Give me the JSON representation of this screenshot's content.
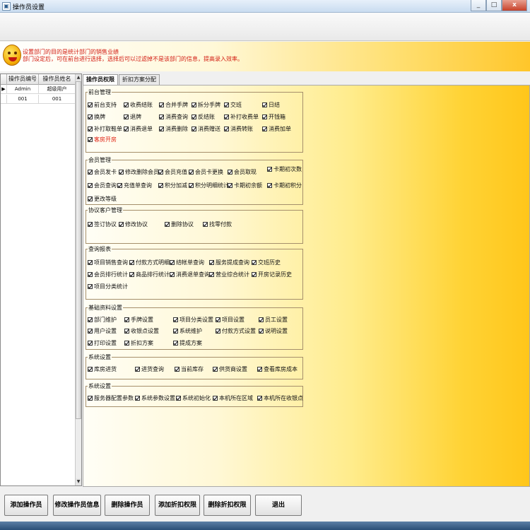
{
  "window": {
    "title": "操作员设置",
    "close_label": "x"
  },
  "notice": {
    "line1": "设置部门的目的是统计部门的销售业绩",
    "line2": "部门设定后，可在前台进行选择，选择后可以过滤掉不是该部门的信息，提高录入效率。"
  },
  "grid": {
    "headers": [
      "操作员编号",
      "操作员姓名"
    ],
    "rows": [
      {
        "indicator": "▶",
        "id": "Admin",
        "name": "超级用户"
      },
      {
        "indicator": "",
        "id": "001",
        "name": "001"
      }
    ]
  },
  "tabs": [
    {
      "label": "操作员权限",
      "active": true
    },
    {
      "label": "折扣方案分配",
      "active": false
    }
  ],
  "groups": [
    {
      "title": "前台管理",
      "items": [
        "前台支持",
        "收费结账",
        "合并手牌",
        "拆分手牌",
        "交班",
        "日结",
        "换牌",
        "退牌",
        "消费查询",
        "反结账",
        "补打收费单",
        "开钱箱",
        "补打取鞋单",
        "消费退单",
        "消费删除",
        "消费赠送",
        "消费转账",
        "消费加单",
        "客房开房"
      ]
    },
    {
      "title": "会员管理",
      "items": [
        "会员发卡",
        "修改删除会员",
        "会员充值",
        "会员卡更换",
        "会员取现",
        "卡期初次数",
        "会员查询",
        "充值单查询",
        "积分加减",
        "积分明细统计",
        "卡期初余额",
        "卡期初积分",
        "更改等级"
      ]
    },
    {
      "title": "协议客户管理",
      "items": [
        "签订协议",
        "修改协议",
        "删除协议",
        "找零付款"
      ]
    },
    {
      "title": "查询报表",
      "items": [
        "项目销售查询",
        "付款方式明细",
        "结帐单查询",
        "服务提成查询",
        "交班历史",
        "会员排行统计",
        "商品排行统计",
        "消费退单查询",
        "营业综合统计",
        "开房记录历史",
        "项目分类统计"
      ]
    },
    {
      "title": "基础资料设置",
      "items": [
        "部门维护",
        "手牌设置",
        "项目分类设置",
        "项目设置",
        "员工设置",
        "用户设置",
        "收银点设置",
        "系统维护",
        "付款方式设置",
        "说明设置",
        "打印设置",
        "折扣方案",
        "提成方案"
      ]
    },
    {
      "title": "系统设置",
      "items": [
        "库房进货",
        "进货查询",
        "当前库存",
        "供货商设置",
        "查看库房成本"
      ]
    },
    {
      "title": "系统设置",
      "items": [
        "服务器配置参数",
        "系统参数设置",
        "系统初始化",
        "本机所在区域",
        "本机所在收银点"
      ]
    }
  ],
  "buttons": {
    "add_operator": "添加操作员",
    "edit_operator": "修改操作员信息",
    "delete_operator": "删除操作员",
    "add_discount": "添加折扣权限",
    "delete_discount": "删除折扣权限",
    "exit": "退出"
  }
}
